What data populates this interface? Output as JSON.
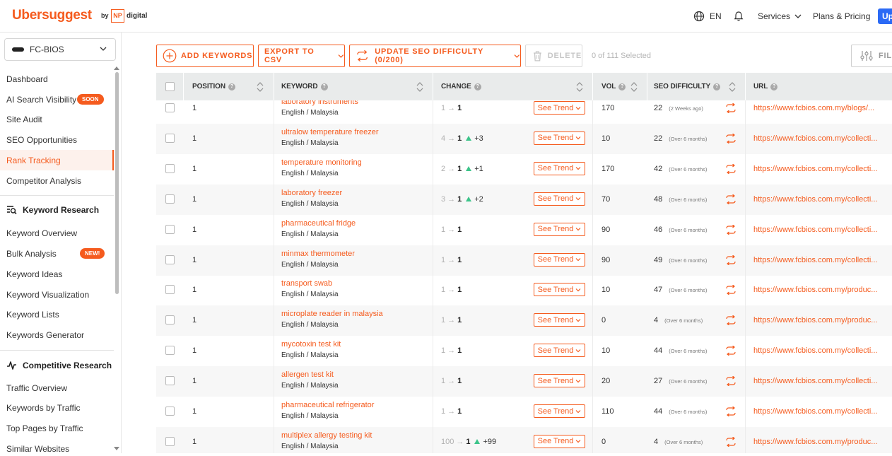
{
  "brand": {
    "name": "Ubersuggest",
    "by": "by",
    "np": "NP",
    "digital": "digital"
  },
  "topnav": {
    "language": "EN",
    "services": "Services",
    "plans": "Plans & Pricing",
    "upgrade": "Up"
  },
  "sidebar": {
    "project": "FC-BIOS",
    "items": [
      {
        "label": "Dashboard"
      },
      {
        "label": "AI Search Visibility",
        "badge": "SOON"
      },
      {
        "label": "Site Audit"
      },
      {
        "label": "SEO Opportunities"
      },
      {
        "label": "Rank Tracking",
        "active": true
      },
      {
        "label": "Competitor Analysis"
      }
    ],
    "keyword_research": {
      "title": "Keyword Research",
      "items": [
        {
          "label": "Keyword Overview"
        },
        {
          "label": "Bulk Analysis",
          "badge": "NEW!"
        },
        {
          "label": "Keyword Ideas"
        },
        {
          "label": "Keyword Visualization"
        },
        {
          "label": "Keyword Lists"
        },
        {
          "label": "Keywords Generator"
        }
      ]
    },
    "competitive_research": {
      "title": "Competitive Research",
      "items": [
        {
          "label": "Traffic Overview"
        },
        {
          "label": "Keywords by Traffic"
        },
        {
          "label": "Top Pages by Traffic"
        },
        {
          "label": "Similar Websites"
        }
      ]
    }
  },
  "toolbar": {
    "add_keywords": "ADD KEYWORDS",
    "export_csv": "EXPORT TO CSV",
    "update_seo": "UPDATE SEO DIFFICULTY (0/200)",
    "delete": "DELETE",
    "selected": "0 of 111 Selected",
    "filter": "FIL"
  },
  "table": {
    "headers": {
      "position": "POSITION",
      "keyword": "KEYWORD",
      "change": "CHANGE",
      "vol": "VOL",
      "seo_difficulty": "SEO DIFFICULTY",
      "url": "URL"
    },
    "trend_label": "See Trend",
    "rows": [
      {
        "position": "1",
        "keyword": "laboratory instruments",
        "location": "English / Malaysia",
        "prev": "1",
        "current": "1",
        "delta": "",
        "vol": "170",
        "sd": "22",
        "ago": "(2 Weeks ago)",
        "url": "https://www.fcbios.com.my/blogs/..."
      },
      {
        "position": "1",
        "keyword": "ultralow temperature freezer",
        "location": "English / Malaysia",
        "prev": "4",
        "current": "1",
        "delta": "+3",
        "vol": "10",
        "sd": "22",
        "ago": "(Over 6 months)",
        "url": "https://www.fcbios.com.my/collecti..."
      },
      {
        "position": "1",
        "keyword": "temperature monitoring",
        "location": "English / Malaysia",
        "prev": "2",
        "current": "1",
        "delta": "+1",
        "vol": "170",
        "sd": "42",
        "ago": "(Over 6 months)",
        "url": "https://www.fcbios.com.my/collecti..."
      },
      {
        "position": "1",
        "keyword": "laboratory freezer",
        "location": "English / Malaysia",
        "prev": "3",
        "current": "1",
        "delta": "+2",
        "vol": "70",
        "sd": "48",
        "ago": "(Over 6 months)",
        "url": "https://www.fcbios.com.my/collecti..."
      },
      {
        "position": "1",
        "keyword": "pharmaceutical fridge",
        "location": "English / Malaysia",
        "prev": "1",
        "current": "1",
        "delta": "",
        "vol": "90",
        "sd": "46",
        "ago": "(Over 6 months)",
        "url": "https://www.fcbios.com.my/collecti..."
      },
      {
        "position": "1",
        "keyword": "minmax thermometer",
        "location": "English / Malaysia",
        "prev": "1",
        "current": "1",
        "delta": "",
        "vol": "90",
        "sd": "49",
        "ago": "(Over 6 months)",
        "url": "https://www.fcbios.com.my/collecti..."
      },
      {
        "position": "1",
        "keyword": "transport swab",
        "location": "English / Malaysia",
        "prev": "1",
        "current": "1",
        "delta": "",
        "vol": "10",
        "sd": "47",
        "ago": "(Over 6 months)",
        "url": "https://www.fcbios.com.my/produc..."
      },
      {
        "position": "1",
        "keyword": "microplate reader in malaysia",
        "location": "English / Malaysia",
        "prev": "1",
        "current": "1",
        "delta": "",
        "vol": "0",
        "sd": "4",
        "ago": "(Over 6 months)",
        "url": "https://www.fcbios.com.my/produc..."
      },
      {
        "position": "1",
        "keyword": "mycotoxin test kit",
        "location": "English / Malaysia",
        "prev": "1",
        "current": "1",
        "delta": "",
        "vol": "10",
        "sd": "44",
        "ago": "(Over 6 months)",
        "url": "https://www.fcbios.com.my/collecti..."
      },
      {
        "position": "1",
        "keyword": "allergen test kit",
        "location": "English / Malaysia",
        "prev": "1",
        "current": "1",
        "delta": "",
        "vol": "20",
        "sd": "27",
        "ago": "(Over 6 months)",
        "url": "https://www.fcbios.com.my/collecti..."
      },
      {
        "position": "1",
        "keyword": "pharmaceutical refrigerator",
        "location": "English / Malaysia",
        "prev": "1",
        "current": "1",
        "delta": "",
        "vol": "110",
        "sd": "44",
        "ago": "(Over 6 months)",
        "url": "https://www.fcbios.com.my/collecti..."
      },
      {
        "position": "1",
        "keyword": "multiplex allergy testing kit",
        "location": "English / Malaysia",
        "prev": "100",
        "current": "1",
        "delta": "+99",
        "vol": "0",
        "sd": "4",
        "ago": "(Over 6 months)",
        "url": "https://www.fcbios.com.my/produc..."
      }
    ]
  },
  "colors": {
    "accent": "#f55b1e",
    "up": "#3cc48a",
    "header_bg": "#e9ebeb",
    "upgrade": "#2b6af5"
  }
}
